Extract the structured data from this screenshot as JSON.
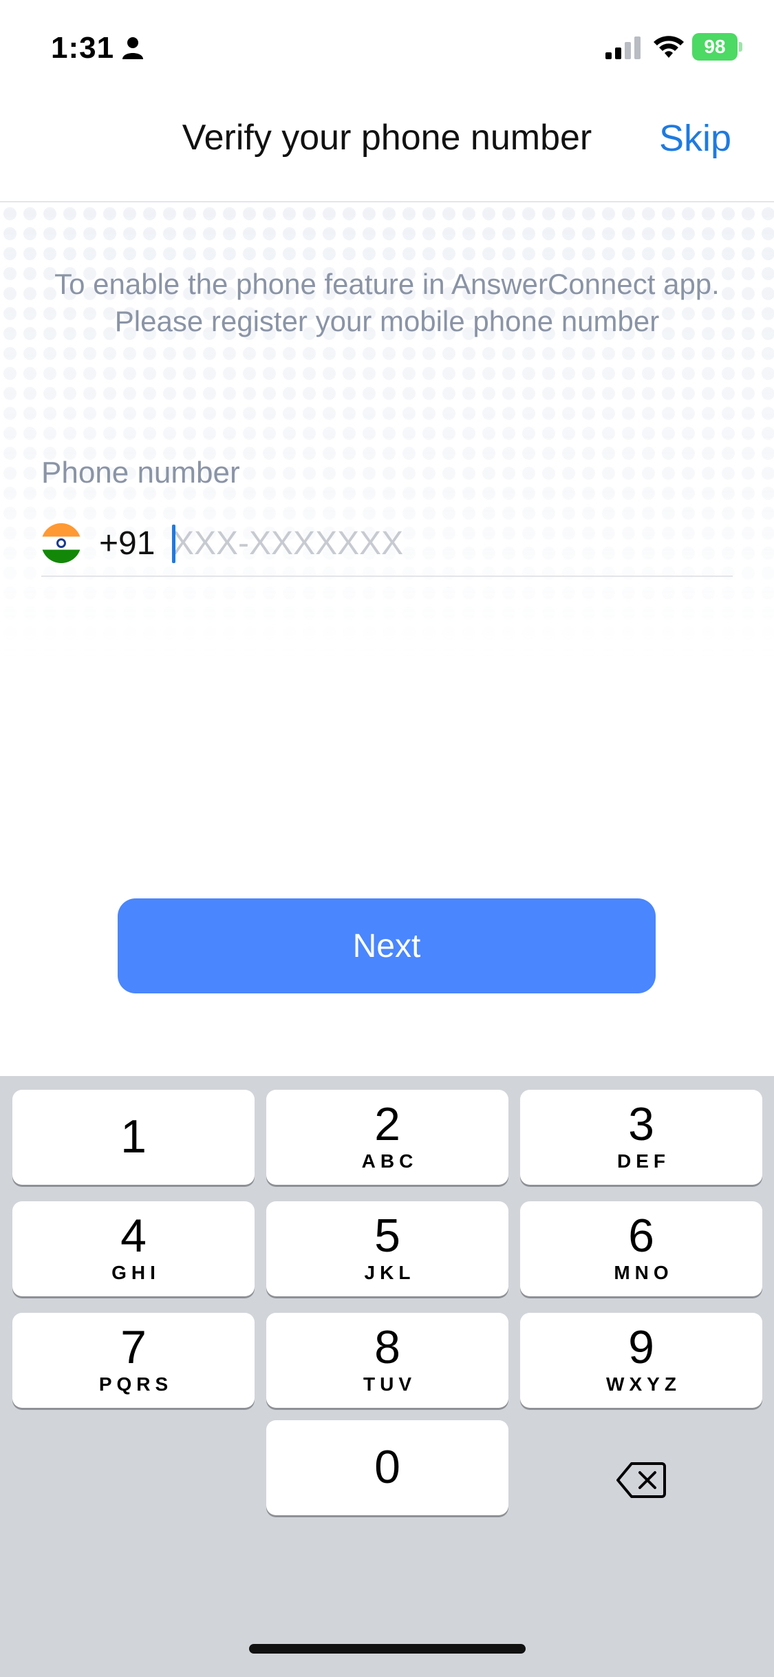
{
  "status_bar": {
    "time": "1:31",
    "battery_level": "98",
    "icons": [
      "person-icon",
      "signal-icon",
      "wifi-icon",
      "battery-icon"
    ]
  },
  "header": {
    "title": "Verify your phone number",
    "skip_label": "Skip"
  },
  "intro_text": "To enable the phone feature in AnswerConnect app. Please register your mobile phone number",
  "phone": {
    "label": "Phone number",
    "country_flag": "india-flag-icon",
    "country_code": "+91",
    "placeholder": "XXX-XXXXXXX",
    "value": ""
  },
  "next_label": "Next",
  "keypad": {
    "keys": [
      {
        "num": "1",
        "letters": ""
      },
      {
        "num": "2",
        "letters": "ABC"
      },
      {
        "num": "3",
        "letters": "DEF"
      },
      {
        "num": "4",
        "letters": "GHI"
      },
      {
        "num": "5",
        "letters": "JKL"
      },
      {
        "num": "6",
        "letters": "MNO"
      },
      {
        "num": "7",
        "letters": "PQRS"
      },
      {
        "num": "8",
        "letters": "TUV"
      },
      {
        "num": "9",
        "letters": "WXYZ"
      },
      {
        "num": "0",
        "letters": ""
      }
    ],
    "delete_icon": "backspace-icon"
  },
  "colors": {
    "accent": "#1f7ae0",
    "button": "#4a86fd",
    "muted_text": "#8a94a6",
    "keypad_bg": "#d1d4d9",
    "battery": "#4cd964"
  }
}
